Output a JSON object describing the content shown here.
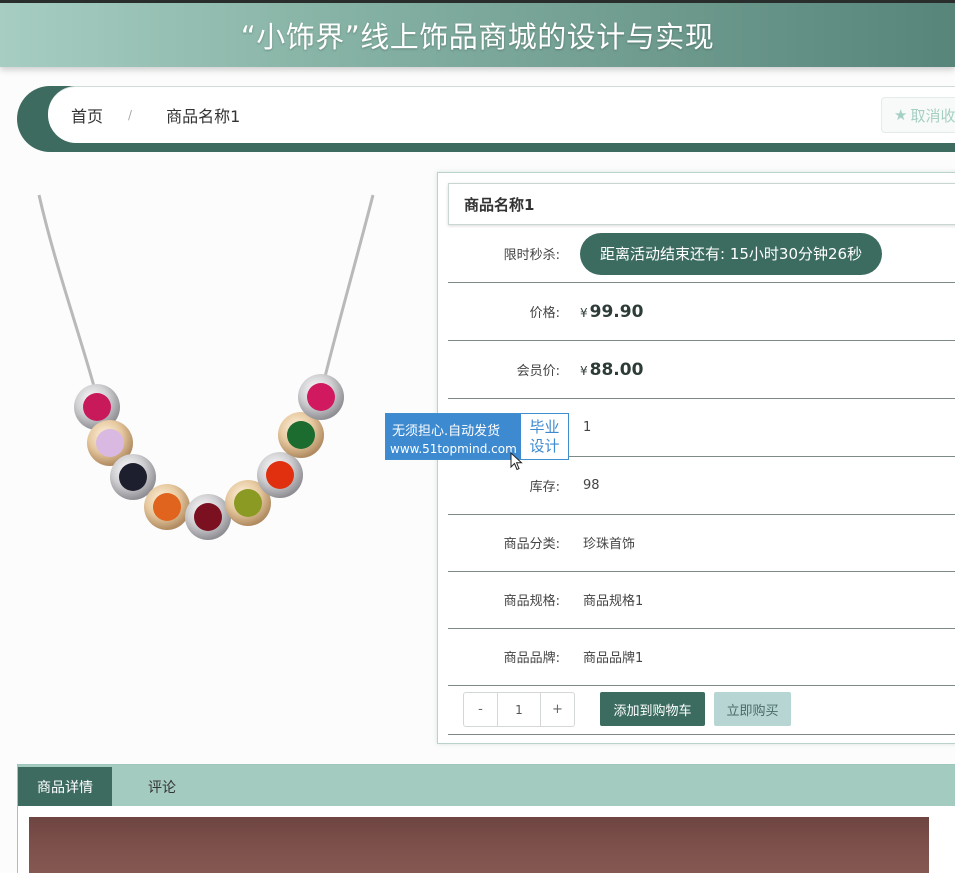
{
  "header": {
    "title": "“小饰界”线上饰品商城的设计与实现"
  },
  "breadcrumb": {
    "home": "首页",
    "separator": "/",
    "current": "商品名称1"
  },
  "favorite": {
    "label": "取消收藏"
  },
  "product": {
    "name": "商品名称1",
    "flash_sale": {
      "label": "限时秒杀:",
      "countdown": "距离活动结束还有: 15小时30分钟26秒"
    },
    "price": {
      "label": "价格:",
      "currency": "¥",
      "value": "99.90"
    },
    "member_price": {
      "label": "会员价:",
      "currency": "¥",
      "value": "88.00"
    },
    "hidden_row": {
      "value": "1"
    },
    "stock": {
      "label": "库存:",
      "value": "98"
    },
    "category": {
      "label": "商品分类:",
      "value": "珍珠首饰"
    },
    "spec": {
      "label": "商品规格:",
      "value": "商品规格1"
    },
    "brand": {
      "label": "商品品牌:",
      "value": "商品品牌1"
    }
  },
  "quantity": {
    "minus": "-",
    "value": "1",
    "plus": "+"
  },
  "actions": {
    "add_to_cart": "添加到购物车",
    "buy_now": "立即购买"
  },
  "watermark": {
    "line1": "无须担心.自动发货",
    "line2": "www.51topmind.com",
    "tag1": "毕业",
    "tag2": "设计"
  },
  "tabs": [
    {
      "label": "商品详情"
    },
    {
      "label": "评论"
    }
  ],
  "icons": {
    "favorite": "star-icon",
    "cursor": "mouse-pointer-icon"
  },
  "colors": {
    "primary": "#3c6c60",
    "accent_light": "#a4cbbf",
    "watermark_blue": "#3d8ad0"
  }
}
